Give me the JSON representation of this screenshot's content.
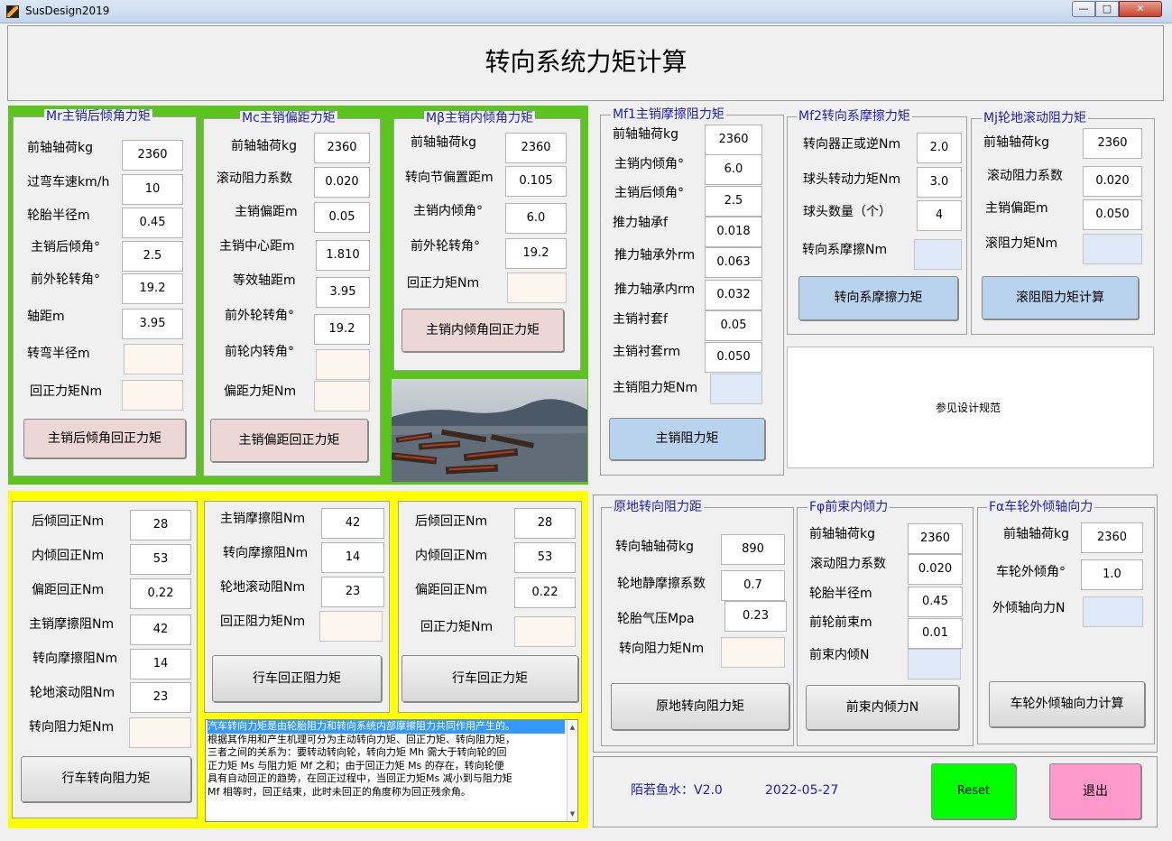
{
  "window": {
    "title": "SusDesign2019",
    "min": "—",
    "max": "□",
    "close": "✕"
  },
  "page_title": "转向系统力矩计算",
  "mr": {
    "legend": "Mr主销后倾角力矩",
    "fields": [
      {
        "label": "前轴轴荷kg",
        "value": "2360"
      },
      {
        "label": "过弯车速km/h",
        "value": "10"
      },
      {
        "label": "轮胎半径m",
        "value": "0.45"
      },
      {
        "label": "主销后倾角°",
        "value": "2.5"
      },
      {
        "label": "前外轮转角°",
        "value": "19.2"
      },
      {
        "label": "轴距m",
        "value": "3.95"
      }
    ],
    "out1": "转弯半径m",
    "out2": "回正力矩Nm",
    "button": "主销后倾角回正力矩"
  },
  "mc": {
    "legend": "Mc主销偏距力矩",
    "fields": [
      {
        "label": "前轴轴荷kg",
        "value": "2360"
      },
      {
        "label": "滚动阻力系数",
        "value": "0.020"
      },
      {
        "label": "主销偏距m",
        "value": "0.05"
      },
      {
        "label": "主销中心距m",
        "value": "1.810"
      },
      {
        "label": "等效轴距m",
        "value": "3.95"
      },
      {
        "label": "前外轮转角°",
        "value": "19.2"
      }
    ],
    "out1": "前轮内转角°",
    "out2": "偏距力矩Nm",
    "button": "主销偏距回正力矩"
  },
  "mb": {
    "legend": "Mβ主销内倾角力矩",
    "fields": [
      {
        "label": "前轴轴荷kg",
        "value": "2360"
      },
      {
        "label": "转向节偏置距m",
        "value": "0.105"
      },
      {
        "label": "主销内倾角°",
        "value": "6.0"
      },
      {
        "label": "前外轮转角°",
        "value": "19.2"
      }
    ],
    "out1": "回正力矩Nm",
    "button": "主销内倾角回正力矩"
  },
  "mf1": {
    "legend": "Mf1主销摩擦阻力矩",
    "fields": [
      {
        "label": "前轴轴荷kg",
        "value": "2360"
      },
      {
        "label": "主销内倾角°",
        "value": "6.0"
      },
      {
        "label": "主销后倾角°",
        "value": "2.5"
      },
      {
        "label": "推力轴承f",
        "value": "0.018"
      },
      {
        "label": "推力轴承外rm",
        "value": "0.063"
      },
      {
        "label": "推力轴承内rm",
        "value": "0.032"
      },
      {
        "label": "主销衬套f",
        "value": "0.05"
      },
      {
        "label": "主销衬套rm",
        "value": "0.050"
      }
    ],
    "out1": "主销阻力矩Nm",
    "button": "主销阻力矩"
  },
  "mf2": {
    "legend": "Mf2转向系摩擦力矩",
    "fields": [
      {
        "label": "转向器正或逆Nm",
        "value": "2.0"
      },
      {
        "label": "球头转动力矩Nm",
        "value": "3.0"
      },
      {
        "label": "球头数量（个）",
        "value": "4"
      }
    ],
    "out1": "转向系摩擦Nm",
    "button": "转向系摩擦力矩"
  },
  "mj": {
    "legend": "Mj轮地滚动阻力矩",
    "fields": [
      {
        "label": "前轴轴荷kg",
        "value": "2360"
      },
      {
        "label": "滚动阻力系数",
        "value": "0.020"
      },
      {
        "label": "主销偏距m",
        "value": "0.050"
      }
    ],
    "out1": "滚阻力矩Nm",
    "button": "滚阻阻力矩计算"
  },
  "ref_text": "参见设计规范",
  "sum1": {
    "fields": [
      {
        "label": "后倾回正Nm",
        "value": "28"
      },
      {
        "label": "内倾回正Nm",
        "value": "53"
      },
      {
        "label": "偏距回正Nm",
        "value": "0.22"
      },
      {
        "label": "主销摩擦阻Nm",
        "value": "42"
      },
      {
        "label": "转向摩擦阻Nm",
        "value": "14"
      },
      {
        "label": "轮地滚动阻Nm",
        "value": "23"
      }
    ],
    "out1": "转向阻力矩Nm",
    "button": "行车转向阻力矩"
  },
  "sum2": {
    "fields": [
      {
        "label": "主销摩擦阻Nm",
        "value": "42"
      },
      {
        "label": "转向摩擦阻Nm",
        "value": "14"
      },
      {
        "label": "轮地滚动阻Nm",
        "value": "23"
      }
    ],
    "out1": "回正阻力矩Nm",
    "button": "行车回正阻力矩"
  },
  "sum3": {
    "fields": [
      {
        "label": "后倾回正Nm",
        "value": "28"
      },
      {
        "label": "内倾回正Nm",
        "value": "53"
      },
      {
        "label": "偏距回正Nm",
        "value": "0.22"
      }
    ],
    "out1": "回正力矩Nm",
    "button": "行车回正力矩"
  },
  "desc": {
    "lines": [
      "汽车转向力矩是由轮胎阻力和转向系统内部摩擦阻力共同作用产生的。",
      "根据其作用和产生机理可分为主动转向力矩、回正力矩、转向阻力矩，",
      "三者之间的关系为：要转动转向轮，转向力矩 Mh 需大于转向轮的回",
      "正力矩 Ms 与阻力矩 Mf 之和；由于回正力矩 Ms 的存在，转向轮便",
      "具有自动回正的趋势，在回正过程中，当回正力矩Ms 减小到与阻力矩",
      "Mf 相等时，回正结束，此时未回正的角度称为回正残余角。"
    ]
  },
  "yd": {
    "legend": "原地转向阻力距",
    "fields": [
      {
        "label": "转向轴轴荷kg",
        "value": "890"
      },
      {
        "label": "轮地静摩擦系数",
        "value": "0.7"
      },
      {
        "label": "轮胎气压Mpa",
        "value": "0.23"
      }
    ],
    "out1": "转向阻力矩Nm",
    "button": "原地转向阻力矩"
  },
  "fq": {
    "legend": "Fφ前束内倾力",
    "fields": [
      {
        "label": "前轴轴荷kg",
        "value": "2360"
      },
      {
        "label": "滚动阻力系数",
        "value": "0.020"
      },
      {
        "label": "轮胎半径m",
        "value": "0.45"
      },
      {
        "label": "前轮前束m",
        "value": "0.01"
      }
    ],
    "out1": "前束内倾N",
    "button": "前束内倾力N"
  },
  "fa": {
    "legend": "Fα车轮外倾轴向力",
    "fields": [
      {
        "label": "前轴轴荷kg",
        "value": "2360"
      },
      {
        "label": "车轮外倾角°",
        "value": "1.0"
      }
    ],
    "out1": "外倾轴向力N",
    "button": "车轮外倾轴向力计算"
  },
  "footer": {
    "version": "陌若鱼水：V2.0",
    "date": "2022-05-27",
    "reset": "Reset",
    "exit": "退出"
  },
  "colors": {
    "green": "#5bc41e",
    "yellow": "#ffff00",
    "reset": "#00ff00",
    "exit": "#ff99cc",
    "legend": "#1f1fb8"
  }
}
